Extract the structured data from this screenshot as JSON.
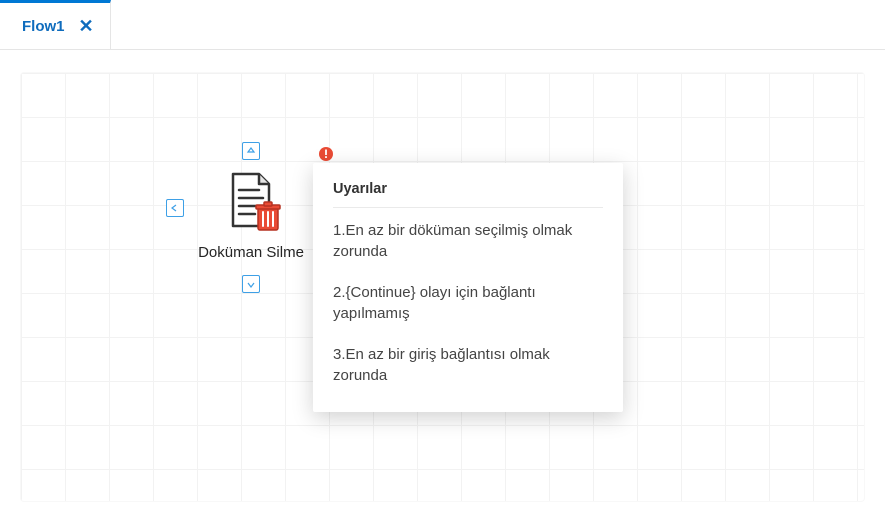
{
  "tab": {
    "label": "Flow1"
  },
  "node": {
    "label": "Doküman Silme"
  },
  "tooltip": {
    "title": "Uyarılar",
    "items": [
      "1.En az bir döküman seçilmiş olmak zorunda",
      "2.{Continue} olayı için bağlantı yapılmamış",
      "3.En az bir giriş bağlantısı olmak zorunda"
    ]
  }
}
